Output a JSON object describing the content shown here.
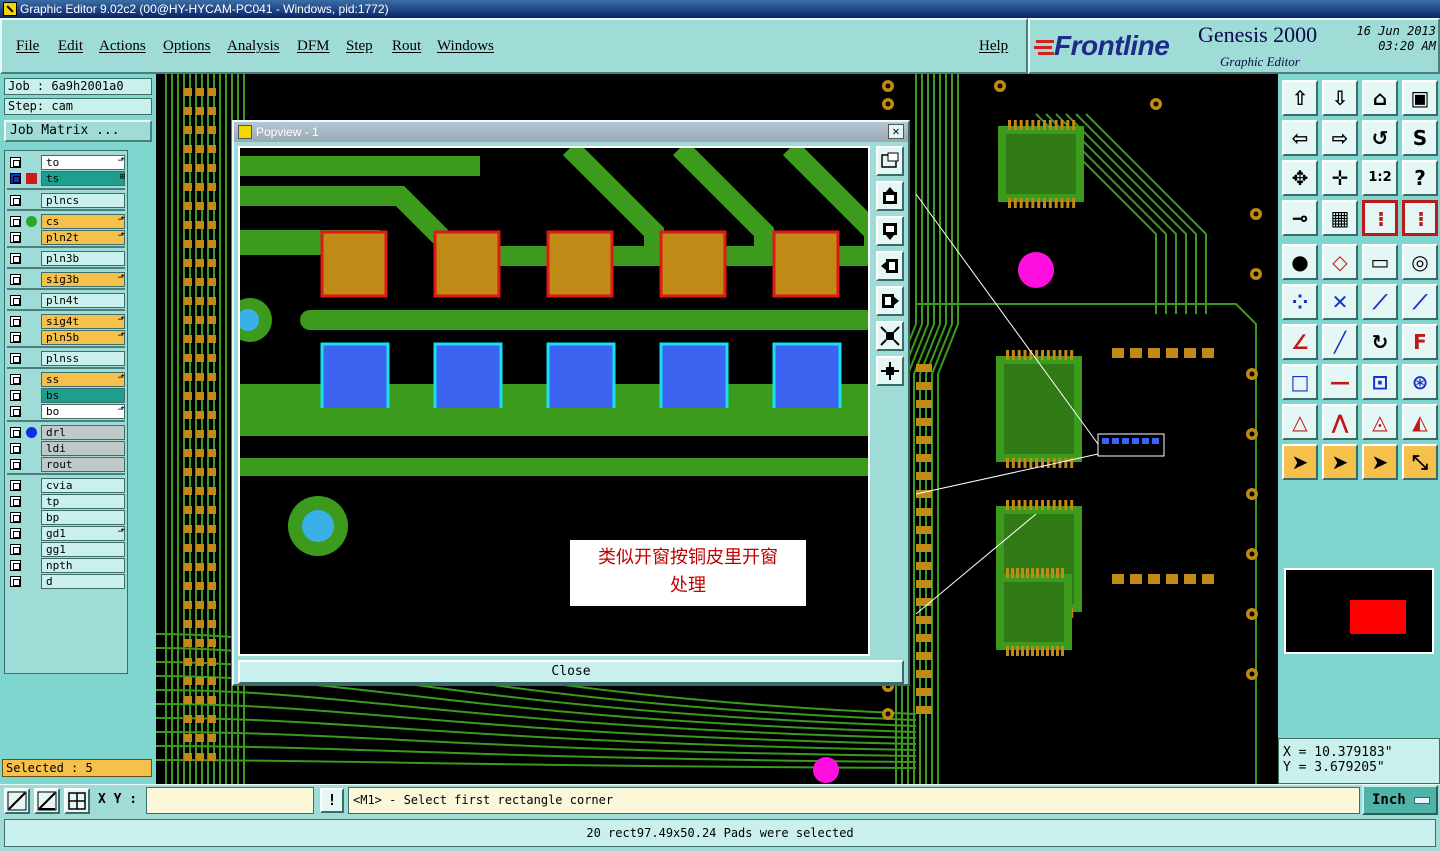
{
  "window": {
    "title": "Graphic Editor 9.02c2 (00@HY-HYCAM-PC041 - Windows, pid:1772)"
  },
  "menu": [
    "File",
    "Edit",
    "Actions",
    "Options",
    "Analysis",
    "DFM",
    "Step",
    "Rout",
    "Windows"
  ],
  "help_label": "Help",
  "brand": {
    "logo": "Frontline",
    "product": "Genesis 2000",
    "subtitle": "Graphic Editor",
    "date": "16 Jun 2013",
    "time": "03:20 AM"
  },
  "job": {
    "job_label": "Job : 6a9h2001a0",
    "step_label": "Step: cam",
    "matrix_button": "Job Matrix ..."
  },
  "layers": [
    {
      "name": "to",
      "color": "#ffffff",
      "flag": "⬏"
    },
    {
      "name": "ts",
      "color": "#1f9e8e",
      "flag": "⊞",
      "active": true
    },
    {
      "name": "plncs",
      "color": "#c9f0ed",
      "flag": ""
    },
    {
      "name": "cs",
      "color": "#f5c04c",
      "flag": "⬏",
      "dot": "#2aa82a"
    },
    {
      "name": "pln2t",
      "color": "#f5c04c",
      "flag": "⬏"
    },
    {
      "name": "pln3b",
      "color": "#c9f0ed",
      "flag": ""
    },
    {
      "name": "sig3b",
      "color": "#f5c04c",
      "flag": "⬏"
    },
    {
      "name": "pln4t",
      "color": "#c9f0ed",
      "flag": ""
    },
    {
      "name": "sig4t",
      "color": "#f5c04c",
      "flag": "⬏"
    },
    {
      "name": "pln5b",
      "color": "#f5c04c",
      "flag": "⬏"
    },
    {
      "name": "plnss",
      "color": "#c9f0ed",
      "flag": ""
    },
    {
      "name": "ss",
      "color": "#f5c04c",
      "flag": "⬏"
    },
    {
      "name": "bs",
      "color": "#1f9e8e",
      "flag": ""
    },
    {
      "name": "bo",
      "color": "#ffffff",
      "flag": "⬏"
    },
    {
      "name": "drl",
      "color": "#c0c8c8",
      "flag": "",
      "dot": "#1030e0"
    },
    {
      "name": "ldi",
      "color": "#c0c8c8",
      "flag": ""
    },
    {
      "name": "rout",
      "color": "#c0c8c8",
      "flag": ""
    },
    {
      "name": "cvia",
      "color": "#c9f0ed",
      "flag": ""
    },
    {
      "name": "tp",
      "color": "#c9f0ed",
      "flag": ""
    },
    {
      "name": "bp",
      "color": "#c9f0ed",
      "flag": ""
    },
    {
      "name": "gd1",
      "color": "#c9f0ed",
      "flag": "⬏"
    },
    {
      "name": "gg1",
      "color": "#c9f0ed",
      "flag": ""
    },
    {
      "name": "npth",
      "color": "#c9f0ed",
      "flag": ""
    },
    {
      "name": "d",
      "color": "#c9f0ed",
      "flag": ""
    }
  ],
  "selected_label": "Selected : 5",
  "popview": {
    "title": "Popview - 1",
    "close_label": "Close",
    "note_line1": "类似开窗按铜皮里开窗",
    "note_line2": "处理"
  },
  "coords": {
    "x": "X = 10.379183\"",
    "y": "Y = 3.679205\""
  },
  "command": {
    "xy_label": "X Y :",
    "xy_value": "",
    "warn": "!",
    "prompt": "<M1> - Select first rectangle corner",
    "units": "Inch"
  },
  "status": "20 rect97.49x50.24 Pads were selected",
  "colors": {
    "panel": "#9fdcd7",
    "copper_green": "#3c9a1c",
    "pad_gold": "#c08a16",
    "pad_red": "#e01818",
    "pad_blue": "#3c64f0",
    "pad_cyan": "#18e0f0",
    "magenta": "#ff10e0"
  },
  "toolbar_icons": [
    "zoom-home-icon",
    "zoom-fit-icon",
    "home-icon",
    "window-split-icon",
    "pan-left-icon",
    "pan-right-icon",
    "redraw-icon",
    "s-snap-icon",
    "zoom-extent-icon",
    "zoom-center-icon",
    "scale-12-icon",
    "help-icon",
    "measure-icon",
    "grid-icon",
    "layer-toggle-icon",
    "layer-select-icon",
    "add-pad-icon",
    "add-shape-icon",
    "ruler-icon",
    "circle-target-icon",
    "connect-icon",
    "cross-icon",
    "line-node-icon",
    "arrow-node-icon",
    "angle-icon",
    "diagonal-icon",
    "rotate-icon",
    "mirror-f-icon",
    "snap-square-icon",
    "horizontal-line-icon",
    "fit-box-icon",
    "drill-icon",
    "triangle-icon",
    "arch-icon",
    "arc-a-icon",
    "arc-b-icon",
    "pointer-icon",
    "select-box-icon",
    "select-arrow-icon",
    "route-icon"
  ]
}
